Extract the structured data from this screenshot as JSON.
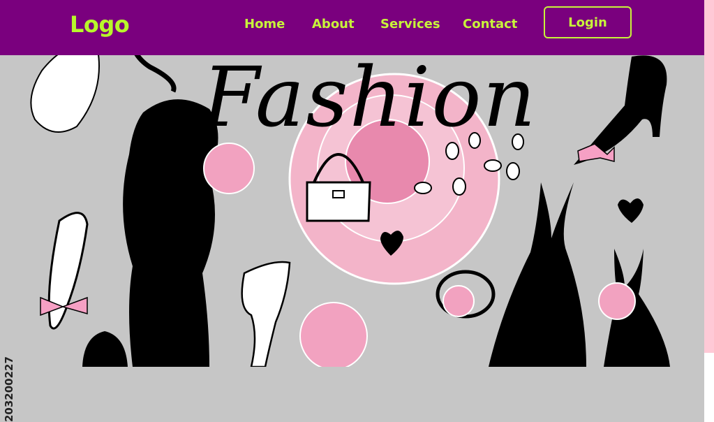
{
  "header": {
    "logo": "Logo",
    "nav": [
      "Home",
      "About",
      "Services",
      "Contact"
    ],
    "login": "Login"
  },
  "hero": {
    "title": "Fashion",
    "stock_id": "203200227"
  },
  "colors": {
    "navbar": "#7a007e",
    "accent": "#c8f43a",
    "background": "#c6c6c6",
    "pink": "#f6a9c4"
  }
}
